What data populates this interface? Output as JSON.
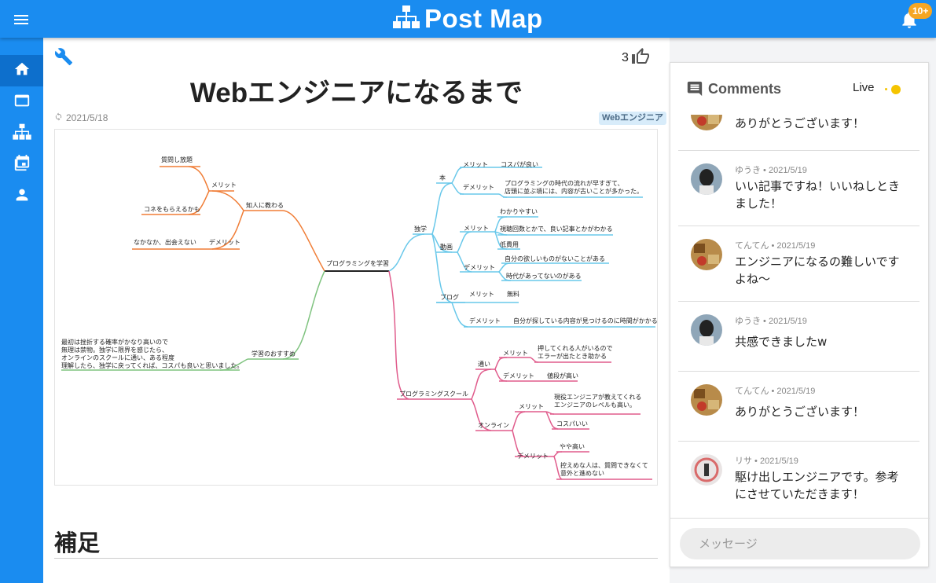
{
  "app": {
    "title": "Post Map",
    "notification_badge": "10+"
  },
  "colors": {
    "brand": "#1a8cf0",
    "brand_dark": "#0d6fcc",
    "live": "#f5c400",
    "badge": "#f5a623"
  },
  "sidebar": {
    "items": [
      {
        "icon": "home-icon",
        "active": true
      },
      {
        "icon": "window-icon"
      },
      {
        "icon": "sitemap-icon"
      },
      {
        "icon": "calendar-icon"
      },
      {
        "icon": "person-icon"
      }
    ]
  },
  "post": {
    "likes": "3",
    "title": "Webエンジニアになるまで",
    "date": "2021/5/18",
    "tag": "Webエンジニア",
    "section_heading": "補足"
  },
  "mindmap": {
    "labels": {
      "root": "プログラミングを学習",
      "n_chijin": "知人に教わる",
      "n_chijin_merit": "メリット",
      "n_shitsumon": "質問し放題",
      "n_kone": "コネをもらえるかも",
      "n_chijin_demerit": "なかなか、出会えない　　デメリット",
      "n_osusume": "学習のおすすめ",
      "n_osusume_text": "最初は挫折する確率がかなり高いので\n無理は禁物。独学に限界を感じたら、\nオンラインのスクールに通い、ある程度\n理解したら、独学に戻ってくれば、コスパも良いと思いました。",
      "n_dokugaku": "独学",
      "n_hon": "本",
      "n_hon_merit": "メリット　　コスパが良い",
      "n_hon_demerit": "デメリット",
      "n_hon_demerit_text": "プログラミングの時代の流れが早すぎて、\n店頭に並ぶ頃には、内容が古いことが多かった。",
      "n_douga": "動画",
      "n_douga_merit": "メリット",
      "n_wakari": "わかりやすい",
      "n_shichou": "視聴回数とかで、良い記事とかがわかる",
      "n_hiyou": "低費用",
      "n_douga_demerit": "デメリット",
      "n_hoshii": "自分の欲しいものがないことがある",
      "n_jidai": "時代があってないのがある",
      "n_blog": "ブログ",
      "n_blog_merit": "メリット　　無料",
      "n_blog_demerit": "デメリット　　自分が探している内容が見つけるのに時間がかかる",
      "n_school": "プログラミングスクール",
      "n_kayoi": "通い",
      "n_kayoi_merit": "メリット",
      "n_kayoi_merit_text": "押してくれる人がいるので\nエラーが出たとき助かる",
      "n_kayoi_demerit": "デメリット　　値段が高い",
      "n_online": "オンライン",
      "n_online_merit": "メリット",
      "n_online_merit_text": "現役エンジニアが教えてくれる\nエンジニアのレベルも高い。",
      "n_cospa": "コスパいい",
      "n_online_demerit": "デメリット",
      "n_yaya": "やや高い",
      "n_hikaeme": "控えめな人は、質問できなくて\n意外と進めない"
    }
  },
  "comments": {
    "title": "Comments",
    "live_label": "Live",
    "input_placeholder": "メッセージ",
    "items": [
      {
        "meta": "",
        "text": "ありがとうございます！",
        "avatar": "tenten"
      },
      {
        "meta": "ゆうき • 2021/5/19",
        "text": "いい記事ですね！いいねしときました！",
        "avatar": "yuuki"
      },
      {
        "meta": "てんてん • 2021/5/19",
        "text": "エンジニアになるの難しいですよね〜",
        "avatar": "tenten"
      },
      {
        "meta": "ゆうき • 2021/5/19",
        "text": "共感できましたw",
        "avatar": "yuuki"
      },
      {
        "meta": "てんてん • 2021/5/19",
        "text": "ありがとうございます！",
        "avatar": "tenten"
      },
      {
        "meta": "リサ • 2021/5/19",
        "text": "駆け出しエンジニアです。参考にさせていただきます！",
        "avatar": "risa"
      }
    ]
  }
}
